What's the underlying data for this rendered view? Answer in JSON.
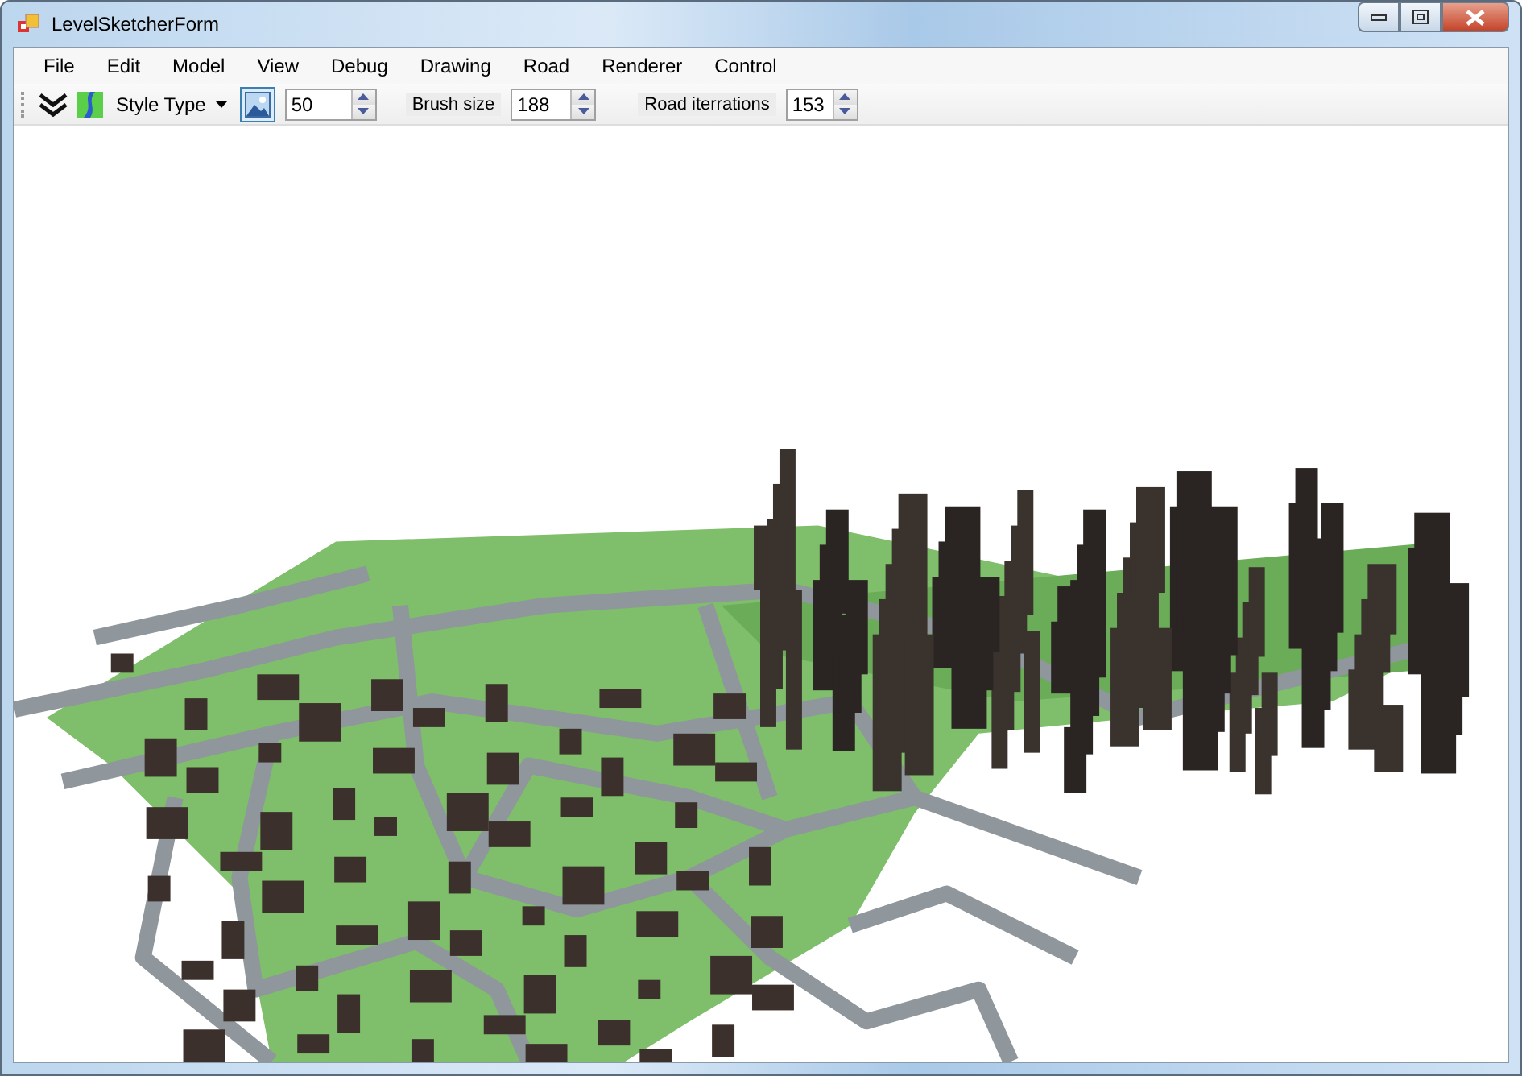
{
  "window": {
    "title": "LevelSketcherForm"
  },
  "menu": [
    "File",
    "Edit",
    "Model",
    "View",
    "Debug",
    "Drawing",
    "Road",
    "Renderer",
    "Control"
  ],
  "toolbar": {
    "style_type": "Style Type",
    "value_field": "50",
    "brush_size_label": "Brush size",
    "brush_size": "188",
    "road_iterations_label": "Road iterrations",
    "road_iterations": "153"
  }
}
